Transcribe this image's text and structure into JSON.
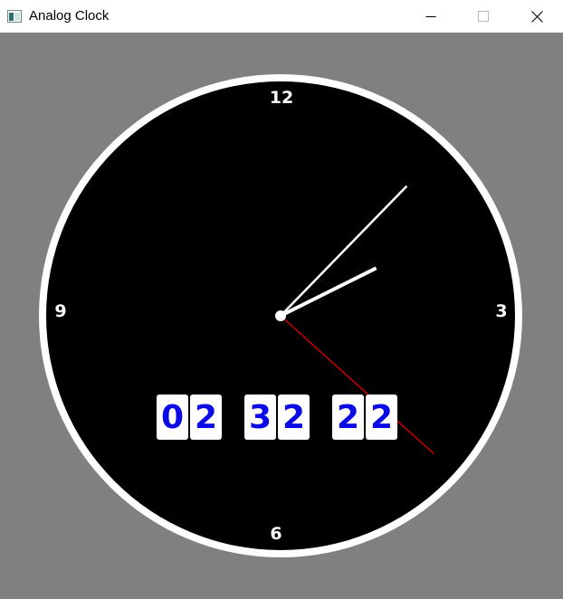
{
  "window": {
    "title": "Analog Clock",
    "icon": "app-window-icon",
    "controls": [
      "minimize-icon",
      "maximize-icon",
      "close-icon"
    ]
  },
  "colors": {
    "background": "#808080",
    "face": "#000000",
    "rim": "#ffffff",
    "hands": "#ffffff",
    "second_hand": "#cc0000",
    "digit_text": "#0a0ae6",
    "digit_card": "#ffffff"
  },
  "clock": {
    "markers": {
      "twelve": "12",
      "three": "3",
      "six": "6",
      "nine": "9"
    },
    "time": {
      "hours": 2,
      "minutes": 7,
      "seconds": 22
    },
    "digital": {
      "h1": "0",
      "h2": "2",
      "m1": "3",
      "m2": "2",
      "s1": "2",
      "s2": "2"
    }
  }
}
